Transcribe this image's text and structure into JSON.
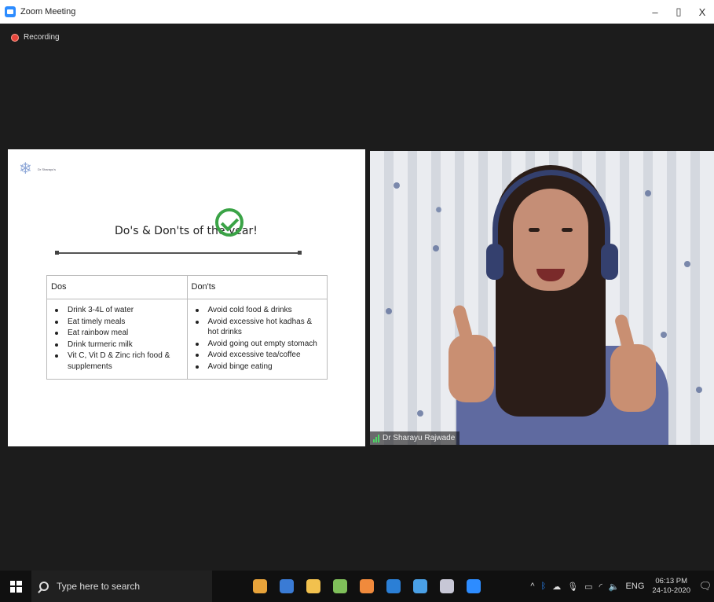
{
  "window": {
    "title": "Zoom Meeting",
    "minimize": "–",
    "restore": "▯",
    "close": "X"
  },
  "meeting": {
    "recording_label": "Recording",
    "participant_name": "Dr Sharayu Rajwade"
  },
  "slide": {
    "logo_text": "Dr Sharayu's",
    "heading": "Do's & Don'ts of the year!",
    "table": {
      "headers": [
        "Dos",
        "Don'ts"
      ],
      "dos": [
        "Drink 3-4L of water",
        "Eat timely meals",
        "Eat rainbow meal",
        "Drink turmeric milk",
        "Vit C, Vit D & Zinc rich food & supplements"
      ],
      "donts": [
        "Avoid cold food & drinks",
        "Avoid excessive hot kadhas & hot drinks",
        "Avoid going out empty stomach",
        "Avoid excessive tea/coffee",
        "Avoid binge eating"
      ]
    }
  },
  "taskbar": {
    "search_placeholder": "Type here to search",
    "apps": [
      {
        "name": "chrome-icon",
        "color": "#e8a33a"
      },
      {
        "name": "store-icon",
        "color": "#3a7bd5"
      },
      {
        "name": "file-explorer-icon",
        "color": "#f2c14e"
      },
      {
        "name": "paint-icon",
        "color": "#7fbf5a"
      },
      {
        "name": "app-orange-icon",
        "color": "#f08a3c"
      },
      {
        "name": "vscode-icon",
        "color": "#2b7fd6"
      },
      {
        "name": "photos-icon",
        "color": "#4aa0e6"
      },
      {
        "name": "snipping-icon",
        "color": "#c7c7d6"
      },
      {
        "name": "zoom-icon",
        "color": "#2d8cff"
      }
    ],
    "tray": {
      "chevron": "^",
      "language": "ENG",
      "time": "06:13 PM",
      "date": "24-10-2020"
    }
  }
}
